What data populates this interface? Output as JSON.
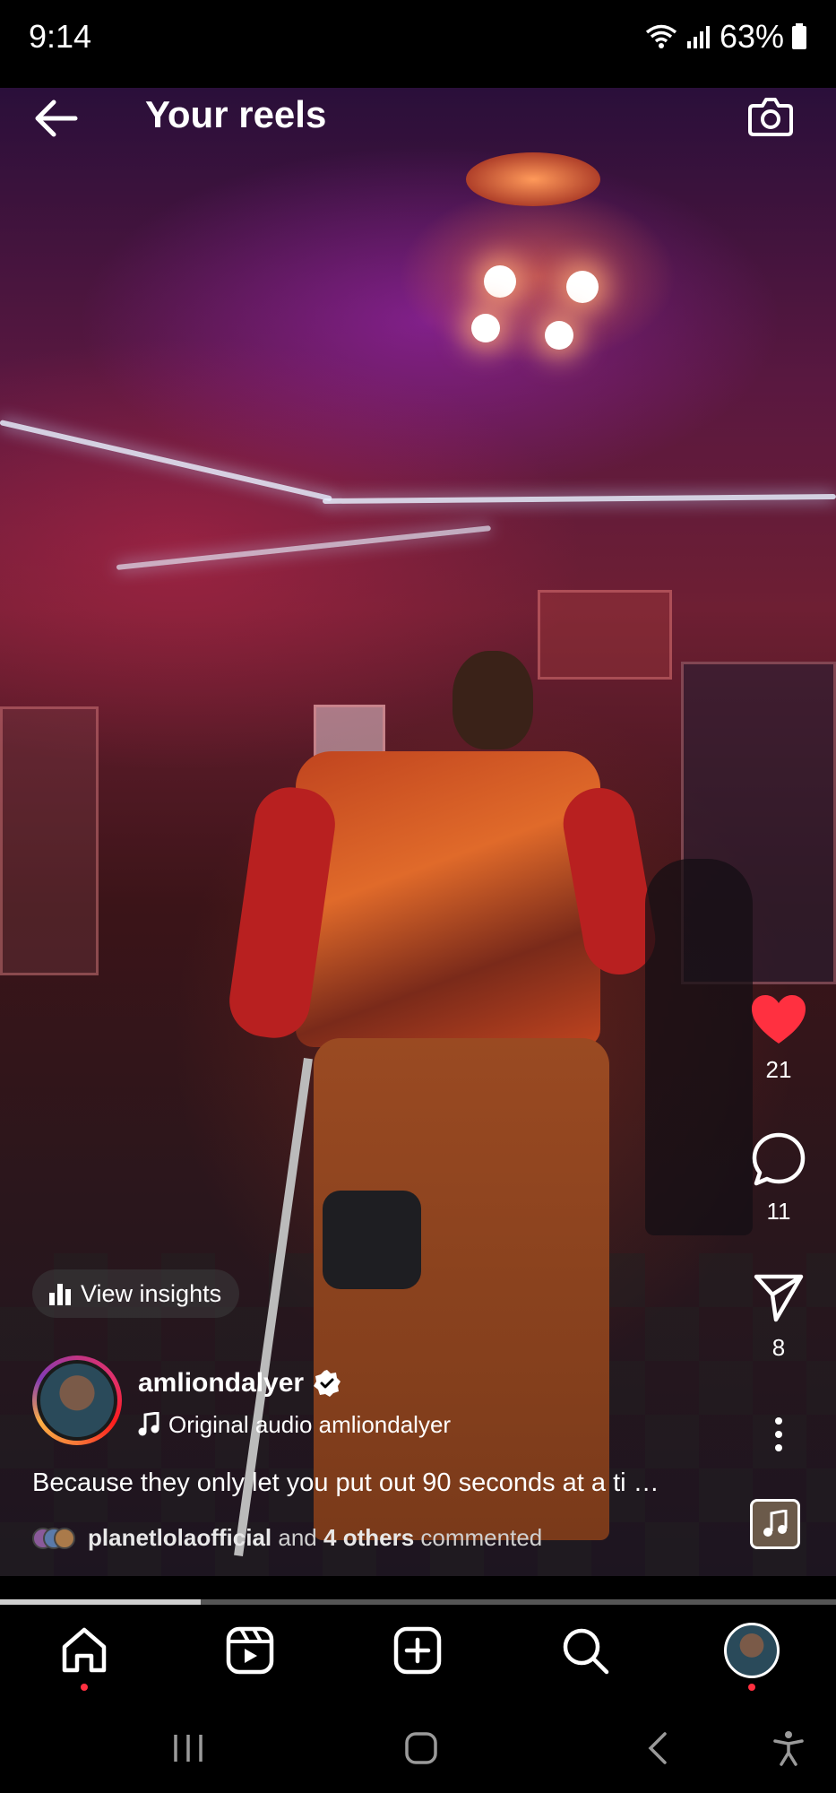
{
  "status_bar": {
    "time": "9:14",
    "battery": "63%"
  },
  "header": {
    "title": "Your reels"
  },
  "actions": {
    "likes": "21",
    "comments": "11",
    "shares": "8"
  },
  "insights": {
    "label": "View insights"
  },
  "author": {
    "username": "amliondalyer",
    "audio_text": "Original audio    amliondalyer"
  },
  "caption": "Because they only let you put out 90 seconds at a ti …",
  "comment_summary": {
    "names": "planetlolaofficial",
    "and": "and",
    "others": "4 others",
    "suffix": "commented"
  },
  "playback": {
    "progress": 0.24
  },
  "colors": {
    "like": "#ff3040",
    "accent_dot": "#ff3040"
  },
  "icons": [
    "back-arrow-icon",
    "camera-icon",
    "heart-icon",
    "comment-icon",
    "send-icon",
    "more-vertical-icon",
    "music-note-icon",
    "bar-chart-icon",
    "verified-icon",
    "home-icon",
    "reels-icon",
    "create-icon",
    "search-icon",
    "wifi-icon",
    "signal-icon",
    "battery-icon"
  ]
}
